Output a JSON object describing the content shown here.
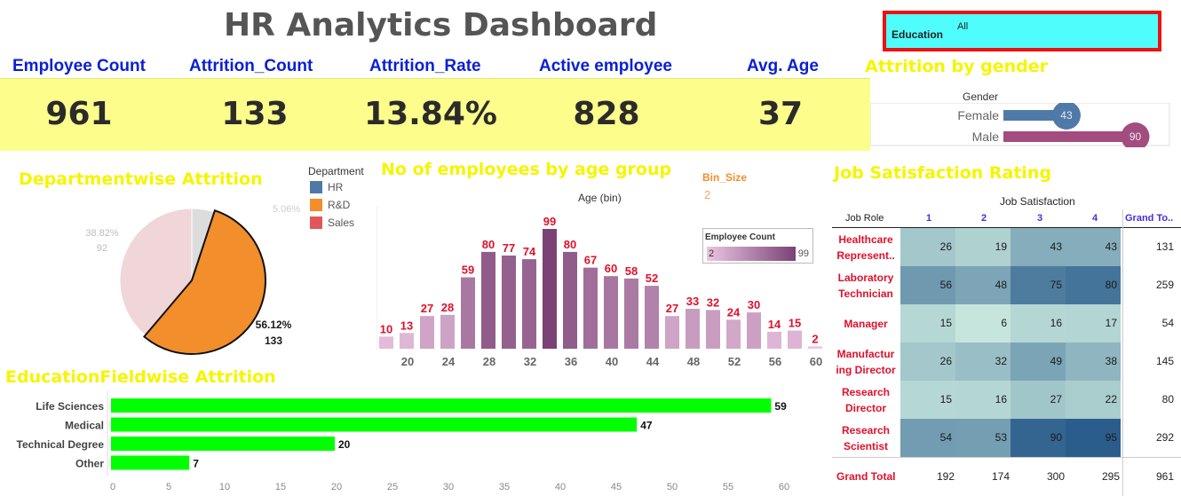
{
  "title": "HR Analytics Dashboard",
  "filter": {
    "label": "Education",
    "value": "All"
  },
  "kpis": [
    {
      "label": "Employee Count",
      "value": "961"
    },
    {
      "label": "Attrition_Count",
      "value": "133"
    },
    {
      "label": "Attrition_Rate",
      "value": "13.84%"
    },
    {
      "label": "Active employee",
      "value": "828"
    },
    {
      "label": "Avg. Age",
      "value": "37"
    }
  ],
  "gender_section": {
    "title": "Attrition by gender",
    "header": "Gender",
    "rows": [
      {
        "label": "Female",
        "value": 43,
        "color": "#4f79a8"
      },
      {
        "label": "Male",
        "value": 90,
        "color": "#a34c7f"
      }
    ]
  },
  "department_section": {
    "title": "Departmentwise Attrition",
    "legend_title": "Department",
    "legend": [
      {
        "label": "HR",
        "color": "#4e79a7"
      },
      {
        "label": "R&D",
        "color": "#f28e2b"
      },
      {
        "label": "Sales",
        "color": "#e15759"
      }
    ],
    "labels": {
      "hr_pct": "5.06%",
      "sales_pct": "38.82%",
      "sales_count": "92",
      "rd_pct": "56.12%",
      "rd_count": "133"
    }
  },
  "age_section": {
    "title": "No of employees by age group",
    "axis_title": "Age (bin)",
    "bin_size_label": "Bin_Size",
    "bin_size_value": "2",
    "legend_title": "Employee Count",
    "legend_min": "2",
    "legend_max": "99"
  },
  "edu_section": {
    "title": "EducationFieldwise Attrition"
  },
  "job_section": {
    "title": "Job Satisfaction Rating",
    "column_header": "Job Satisfaction",
    "role_header": "Job Role",
    "levels": [
      "1",
      "2",
      "3",
      "4"
    ],
    "grand_total_header": "Grand To..",
    "rows": [
      {
        "role": [
          "Healthcare",
          "Represent.."
        ],
        "values": [
          "26",
          "19",
          "43",
          "43"
        ],
        "total": "131"
      },
      {
        "role": [
          "Laboratory",
          "Technician"
        ],
        "values": [
          "56",
          "48",
          "75",
          "80"
        ],
        "total": "259"
      },
      {
        "role": [
          "Manager"
        ],
        "values": [
          "15",
          "6",
          "16",
          "17"
        ],
        "total": "54"
      },
      {
        "role": [
          "Manufactur",
          "ing Director"
        ],
        "values": [
          "26",
          "32",
          "49",
          "38"
        ],
        "total": "145"
      },
      {
        "role": [
          "Research",
          "Director"
        ],
        "values": [
          "15",
          "16",
          "27",
          "22"
        ],
        "total": "80"
      },
      {
        "role": [
          "Research",
          "Scientist"
        ],
        "values": [
          "54",
          "53",
          "90",
          "95"
        ],
        "total": "292"
      }
    ],
    "grand_total_label": "Grand Total",
    "grand_totals": [
      "192",
      "174",
      "300",
      "295"
    ],
    "grand_total_all": "961"
  },
  "chart_data": [
    {
      "type": "pie",
      "title": "Departmentwise Attrition",
      "categories": [
        "HR",
        "R&D",
        "Sales"
      ],
      "values": [
        5.06,
        56.12,
        38.82
      ],
      "counts": [
        null,
        133,
        92
      ],
      "colors": [
        "#4e79a7",
        "#f28e2b",
        "#e15759"
      ],
      "highlighted": "R&D"
    },
    {
      "type": "bar",
      "title": "No of employees by age group",
      "xlabel": "Age (bin)",
      "x": [
        18,
        20,
        22,
        24,
        26,
        28,
        30,
        32,
        34,
        36,
        38,
        40,
        42,
        44,
        46,
        48,
        50,
        52,
        54,
        56,
        58,
        60
      ],
      "values": [
        10,
        13,
        27,
        28,
        59,
        80,
        77,
        74,
        99,
        80,
        67,
        60,
        58,
        52,
        27,
        33,
        32,
        24,
        30,
        14,
        15,
        2
      ],
      "xticks": [
        "20",
        "24",
        "28",
        "32",
        "36",
        "40",
        "44",
        "48",
        "52",
        "56",
        "60"
      ],
      "color_range": [
        "#ecc6e2",
        "#7a4275"
      ]
    },
    {
      "type": "bar",
      "orientation": "horizontal",
      "title": "EducationFieldwise Attrition",
      "categories": [
        "Life Sciences",
        "Medical",
        "Technical Degree",
        "Other"
      ],
      "values": [
        59,
        47,
        20,
        7
      ],
      "xlim": [
        0,
        60
      ],
      "xticks": [
        "0",
        "5",
        "10",
        "15",
        "20",
        "25",
        "30",
        "35",
        "40",
        "45",
        "50",
        "55",
        "60"
      ],
      "color": "#00ff00"
    },
    {
      "type": "bar",
      "orientation": "horizontal",
      "title": "Attrition by gender",
      "categories": [
        "Female",
        "Male"
      ],
      "values": [
        43,
        90
      ],
      "colors": [
        "#4f79a8",
        "#a34c7f"
      ]
    },
    {
      "type": "heatmap",
      "title": "Job Satisfaction Rating",
      "rows": [
        "Healthcare Represent..",
        "Laboratory Technician",
        "Manager",
        "Manufacturing Director",
        "Research Director",
        "Research Scientist"
      ],
      "columns": [
        "1",
        "2",
        "3",
        "4"
      ],
      "values": [
        [
          26,
          19,
          43,
          43
        ],
        [
          56,
          48,
          75,
          80
        ],
        [
          15,
          6,
          16,
          17
        ],
        [
          26,
          32,
          49,
          38
        ],
        [
          15,
          16,
          27,
          22
        ],
        [
          54,
          53,
          90,
          95
        ]
      ],
      "row_totals": [
        131,
        259,
        54,
        145,
        80,
        292
      ],
      "column_totals": [
        192,
        174,
        300,
        295
      ],
      "grand_total": 961
    }
  ]
}
